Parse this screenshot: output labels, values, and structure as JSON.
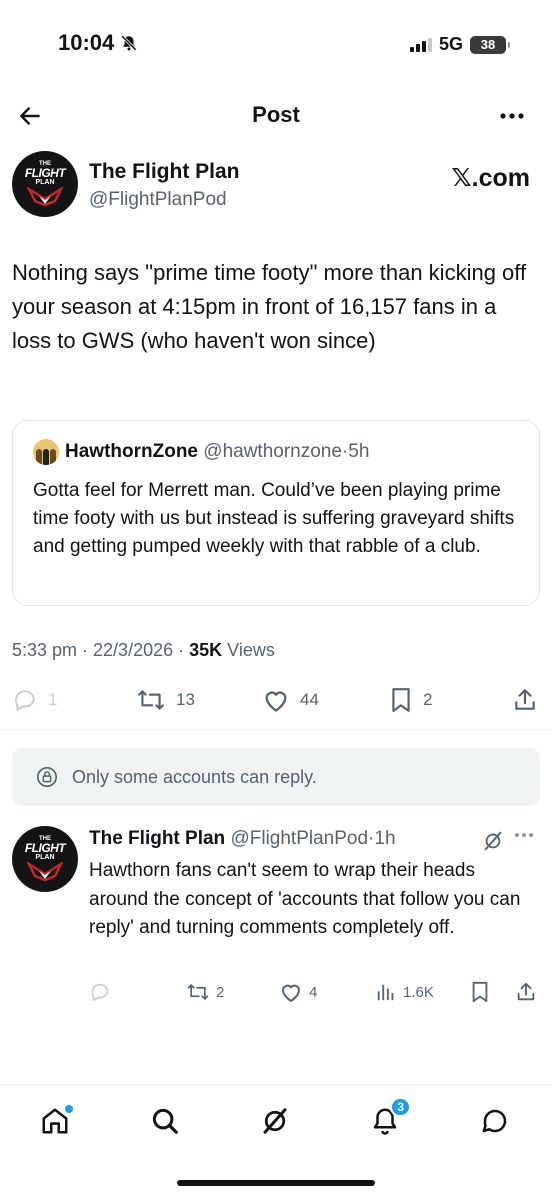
{
  "status_bar": {
    "time": "10:04",
    "network": "5G",
    "battery": "38"
  },
  "header": {
    "title": "Post"
  },
  "post": {
    "author_name": "The Flight Plan",
    "author_handle": "@FlightPlanPod",
    "source_label": "𝕏.com",
    "avatar_text_top": "THE",
    "avatar_text_main": "FLIGHT",
    "avatar_text_sub": "PLAN",
    "text": "Nothing says \"prime time footy\" more than kicking off your season at 4:15pm in front of 16,157 fans in a loss to GWS (who haven't won since)",
    "quote": {
      "name": "HawthornZone",
      "handle": "@hawthornzone",
      "time": "5h",
      "text": "Gotta feel for Merrett man. Could’ve been playing prime time footy with us but instead is suffering graveyard shifts and getting pumped weekly with that rabble of a club."
    },
    "timestamp": "5:33 pm · 22/3/2026 · ",
    "views_count": "35K",
    "views_label": " Views",
    "stats": {
      "replies": "1",
      "reposts": "13",
      "likes": "44",
      "bookmarks": "2"
    }
  },
  "reply_restriction": {
    "text": "Only some accounts can reply."
  },
  "reply": {
    "author_name": "The Flight Plan",
    "author_handle": "@FlightPlanPod",
    "time": "1h",
    "text": "Hawthorn fans can't seem to wrap their heads around the concept of 'accounts that follow you can reply' and turning comments completely off.",
    "stats": {
      "reposts": "2",
      "likes": "4",
      "views": "1.6K"
    }
  },
  "tabbar": {
    "notifications_badge": "3"
  },
  "colors": {
    "text": "#0f1419",
    "secondary": "#536471",
    "accent": "#1d9bf0",
    "banner_bg": "#eff3f4"
  }
}
